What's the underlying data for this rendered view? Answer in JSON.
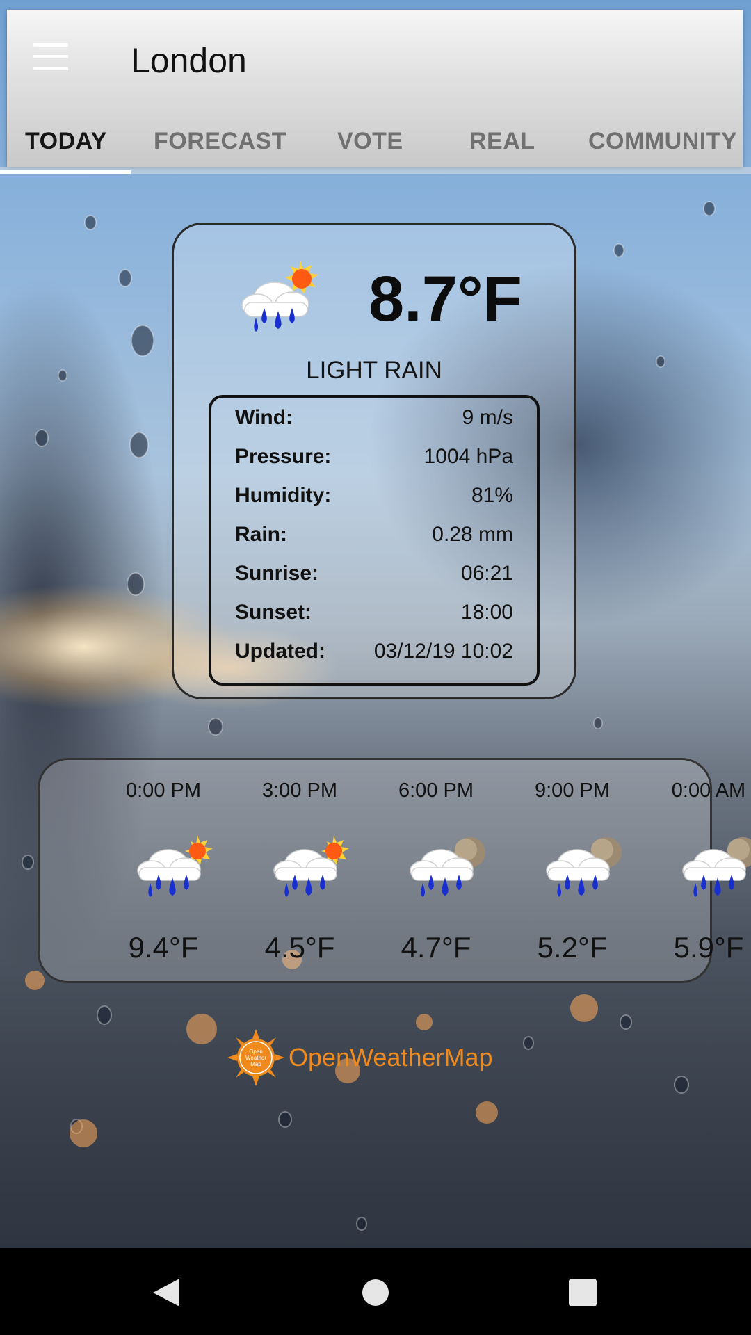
{
  "app": {
    "city": "London"
  },
  "tabs": [
    {
      "label": "TODAY",
      "active": true
    },
    {
      "label": "FORECAST",
      "active": false
    },
    {
      "label": "VOTE",
      "active": false
    },
    {
      "label": "REAL",
      "active": false
    },
    {
      "label": "COMMUNITY",
      "active": false
    }
  ],
  "current": {
    "icon": "rain-cloud-sun-icon",
    "temperature": "8.7°F",
    "description": "LIGHT RAIN",
    "details": [
      {
        "label": "Wind:",
        "value": "9 m/s"
      },
      {
        "label": "Pressure:",
        "value": "1004 hPa"
      },
      {
        "label": "Humidity:",
        "value": "81%"
      },
      {
        "label": "Rain:",
        "value": "0.28 mm"
      },
      {
        "label": "Sunrise:",
        "value": "06:21"
      },
      {
        "label": "Sunset:",
        "value": "18:00"
      },
      {
        "label": "Updated:",
        "value": "03/12/19 10:02"
      }
    ]
  },
  "hourly": [
    {
      "time": "0:00 PM",
      "icon": "rain-cloud-sun-icon",
      "temp": "9.4°F"
    },
    {
      "time": "3:00 PM",
      "icon": "rain-cloud-sun-icon",
      "temp": "4.5°F"
    },
    {
      "time": "6:00 PM",
      "icon": "rain-cloud-moon-icon",
      "temp": "4.7°F"
    },
    {
      "time": "9:00 PM",
      "icon": "rain-cloud-moon-icon",
      "temp": "5.2°F"
    },
    {
      "time": "0:00 AM",
      "icon": "rain-cloud-moon-icon",
      "temp": "5.9°F"
    }
  ],
  "attribution": {
    "name": "OpenWeatherMap",
    "logo_text": "Open Weather Map"
  },
  "colors": {
    "accent_orange": "#f08a1c",
    "sun": "#ff6a1a",
    "raindrop": "#1a2fd0"
  },
  "navbar": {
    "icons": [
      "back-icon",
      "home-icon",
      "recents-icon"
    ]
  }
}
